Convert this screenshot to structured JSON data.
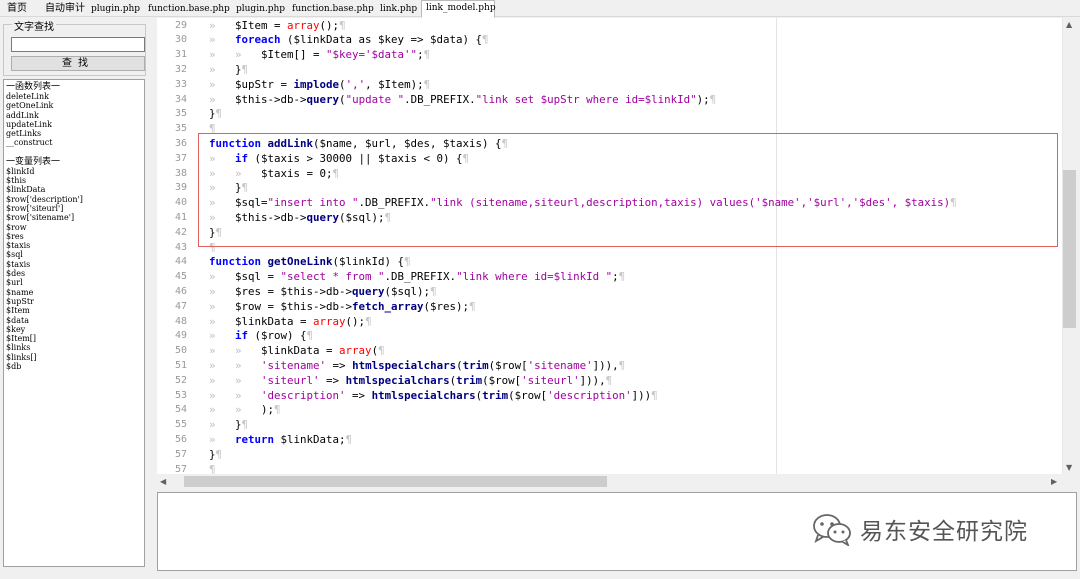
{
  "tabs": [
    {
      "label": "首页",
      "cn": true
    },
    {
      "label": "自动审计",
      "cn": true
    },
    {
      "label": "plugin.php",
      "cn": false
    },
    {
      "label": "function.base.php",
      "cn": false
    },
    {
      "label": "plugin.php",
      "cn": false
    },
    {
      "label": "function.base.php",
      "cn": false
    },
    {
      "label": "link.php",
      "cn": false
    },
    {
      "label": "link_model.php",
      "cn": false,
      "active": true
    }
  ],
  "search": {
    "group_title": "文字查找",
    "input_value": "",
    "button_label": "查找"
  },
  "functions": {
    "heading": "一函数列表一",
    "items": [
      "deleteLink",
      "getOneLink",
      "addLink",
      "updateLink",
      "getLinks",
      "__construct"
    ]
  },
  "variables": {
    "heading": "一变量列表一",
    "items": [
      "$linkId",
      "$this",
      "$linkData",
      "$row['description']",
      "$row['siteurl']",
      "$row['sitename']",
      "$row",
      "$res",
      "$taxis",
      "$sql",
      "$taxis",
      "$des",
      "$url",
      "$name",
      "$upStr",
      "$Item",
      "$data",
      "$key",
      "$Item[]",
      "$links",
      "$links[]",
      "$db"
    ]
  },
  "editor": {
    "lines": [
      {
        "n": "29",
        "tabs": 1,
        "segs": [
          [
            "",
            "$Item = "
          ],
          [
            "pp",
            "array"
          ],
          [
            "",
            "();"
          ]
        ]
      },
      {
        "n": "30",
        "tabs": 1,
        "segs": [
          [
            "kw",
            "foreach"
          ],
          [
            "",
            " ($linkData as $key => $data) {"
          ]
        ]
      },
      {
        "n": "31",
        "tabs": 2,
        "segs": [
          [
            "",
            "$Item[] = "
          ],
          [
            "str",
            "\"$key='$data'\""
          ],
          [
            "",
            ";"
          ]
        ]
      },
      {
        "n": "32",
        "tabs": 1,
        "segs": [
          [
            "",
            "}"
          ]
        ]
      },
      {
        "n": "33",
        "tabs": 1,
        "segs": [
          [
            "",
            "$upStr = "
          ],
          [
            "fn",
            "implode"
          ],
          [
            "",
            "("
          ],
          [
            "str",
            "','"
          ],
          [
            "",
            ", $Item);"
          ]
        ]
      },
      {
        "n": "34",
        "tabs": 1,
        "segs": [
          [
            "",
            "$this->db->"
          ],
          [
            "fn",
            "query"
          ],
          [
            "",
            "("
          ],
          [
            "str",
            "\"update \""
          ],
          [
            "",
            ".DB_PREFIX."
          ],
          [
            "str",
            "\"link set $upStr where id=$linkId\""
          ],
          [
            "",
            ");"
          ]
        ]
      },
      {
        "n": "35",
        "tabs": 0,
        "segs": [
          [
            "",
            "}"
          ]
        ]
      },
      {
        "n": "35",
        "tabs": 0,
        "segs": []
      },
      {
        "n": "36",
        "tabs": 0,
        "segs": [
          [
            "kw",
            "function"
          ],
          [
            "",
            " "
          ],
          [
            "fn",
            "addLink"
          ],
          [
            "",
            "($name, $url, $des, $taxis) {"
          ]
        ]
      },
      {
        "n": "37",
        "tabs": 1,
        "segs": [
          [
            "kw",
            "if"
          ],
          [
            "",
            " ($taxis > 30000 || $taxis < 0) {"
          ]
        ]
      },
      {
        "n": "38",
        "tabs": 2,
        "segs": [
          [
            "",
            "$taxis = 0;"
          ]
        ]
      },
      {
        "n": "39",
        "tabs": 1,
        "segs": [
          [
            "",
            "}"
          ]
        ]
      },
      {
        "n": "40",
        "tabs": 1,
        "segs": [
          [
            "",
            "$sql="
          ],
          [
            "str",
            "\"insert into \""
          ],
          [
            "",
            ".DB_PREFIX."
          ],
          [
            "str",
            "\"link (sitename,siteurl,description,taxis) values('$name','$url','$des', $taxis)"
          ]
        ]
      },
      {
        "n": "41",
        "tabs": 1,
        "segs": [
          [
            "",
            "$this->db->"
          ],
          [
            "fn",
            "query"
          ],
          [
            "",
            "($sql);"
          ]
        ]
      },
      {
        "n": "42",
        "tabs": 0,
        "segs": [
          [
            "",
            "}"
          ]
        ]
      },
      {
        "n": "43",
        "tabs": 0,
        "segs": []
      },
      {
        "n": "44",
        "tabs": 0,
        "segs": [
          [
            "kw",
            "function"
          ],
          [
            "",
            " "
          ],
          [
            "fn",
            "getOneLink"
          ],
          [
            "",
            "($linkId) {"
          ]
        ]
      },
      {
        "n": "45",
        "tabs": 1,
        "segs": [
          [
            "",
            "$sql = "
          ],
          [
            "str",
            "\"select * from \""
          ],
          [
            "",
            ".DB_PREFIX."
          ],
          [
            "str",
            "\"link where id=$linkId \""
          ],
          [
            "",
            ";"
          ]
        ]
      },
      {
        "n": "46",
        "tabs": 1,
        "segs": [
          [
            "",
            "$res = $this->db->"
          ],
          [
            "fn",
            "query"
          ],
          [
            "",
            "($sql);"
          ]
        ]
      },
      {
        "n": "47",
        "tabs": 1,
        "segs": [
          [
            "",
            "$row = $this->db->"
          ],
          [
            "fn",
            "fetch_array"
          ],
          [
            "",
            "($res);"
          ]
        ]
      },
      {
        "n": "48",
        "tabs": 1,
        "segs": [
          [
            "",
            "$linkData = "
          ],
          [
            "pp",
            "array"
          ],
          [
            "",
            "();"
          ]
        ]
      },
      {
        "n": "49",
        "tabs": 1,
        "segs": [
          [
            "kw",
            "if"
          ],
          [
            "",
            " ($row) {"
          ]
        ]
      },
      {
        "n": "50",
        "tabs": 2,
        "segs": [
          [
            "",
            "$linkData = "
          ],
          [
            "pp",
            "array"
          ],
          [
            "",
            "("
          ]
        ]
      },
      {
        "n": "51",
        "tabs": 2,
        "segs": [
          [
            "str",
            "'sitename'"
          ],
          [
            "",
            " => "
          ],
          [
            "fn",
            "htmlspecialchars"
          ],
          [
            "",
            "("
          ],
          [
            "fn",
            "trim"
          ],
          [
            "",
            "($row["
          ],
          [
            "str",
            "'sitename'"
          ],
          [
            "",
            "])),"
          ]
        ]
      },
      {
        "n": "52",
        "tabs": 2,
        "segs": [
          [
            "str",
            "'siteurl'"
          ],
          [
            "",
            " => "
          ],
          [
            "fn",
            "htmlspecialchars"
          ],
          [
            "",
            "("
          ],
          [
            "fn",
            "trim"
          ],
          [
            "",
            "($row["
          ],
          [
            "str",
            "'siteurl'"
          ],
          [
            "",
            "])),"
          ]
        ]
      },
      {
        "n": "53",
        "tabs": 2,
        "segs": [
          [
            "str",
            "'description'"
          ],
          [
            "",
            " => "
          ],
          [
            "fn",
            "htmlspecialchars"
          ],
          [
            "",
            "("
          ],
          [
            "fn",
            "trim"
          ],
          [
            "",
            "($row["
          ],
          [
            "str",
            "'description'"
          ],
          [
            "",
            "]))"
          ]
        ]
      },
      {
        "n": "54",
        "tabs": 2,
        "segs": [
          [
            "",
            ");"
          ]
        ]
      },
      {
        "n": "55",
        "tabs": 1,
        "segs": [
          [
            "",
            "}"
          ]
        ]
      },
      {
        "n": "56",
        "tabs": 1,
        "segs": [
          [
            "kw",
            "return"
          ],
          [
            "",
            " $linkData;"
          ]
        ]
      },
      {
        "n": "57",
        "tabs": 0,
        "segs": [
          [
            "",
            "}"
          ]
        ]
      },
      {
        "n": "57",
        "tabs": 0,
        "segs": []
      }
    ]
  },
  "watermark": {
    "text": "易东安全研究院",
    "icon": "wechat-icon"
  },
  "output": {
    "text": ""
  }
}
